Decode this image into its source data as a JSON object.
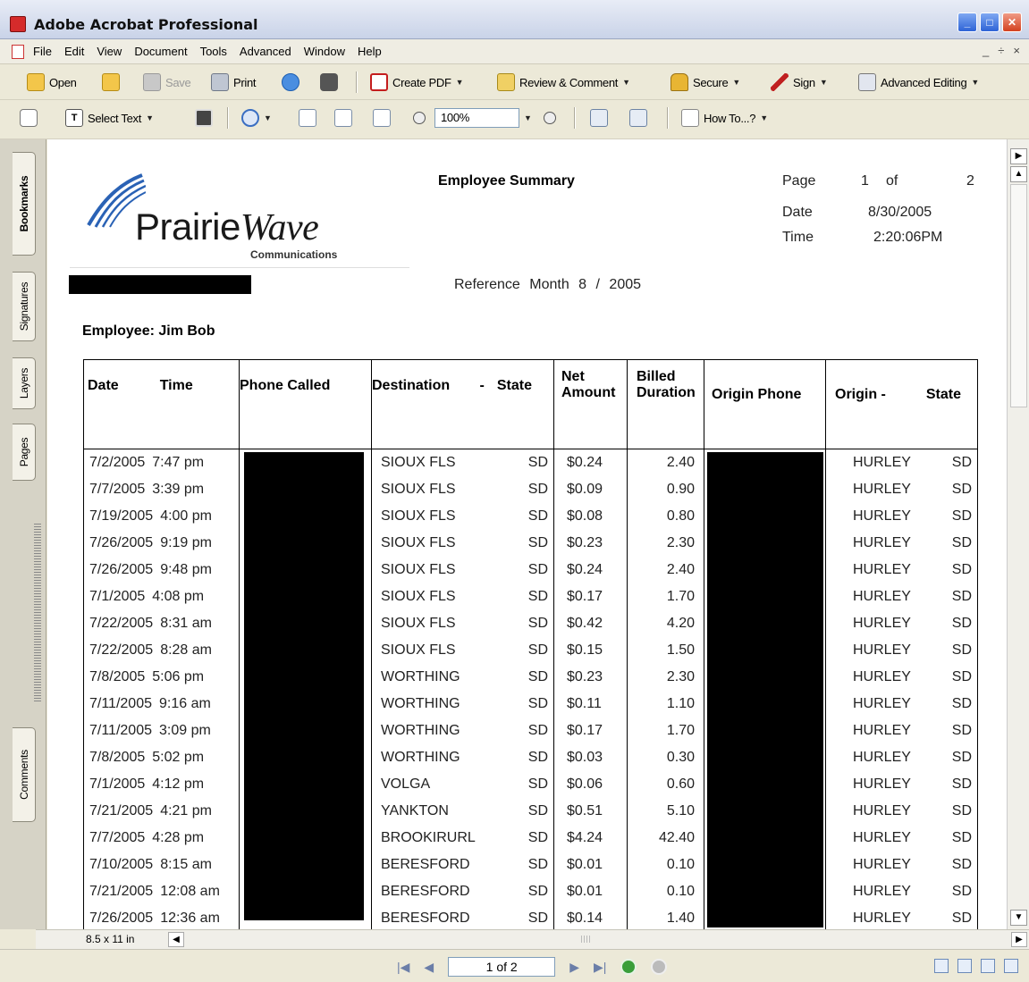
{
  "window": {
    "title": "Adobe Acrobat Professional"
  },
  "menubar": {
    "items": [
      "File",
      "Edit",
      "View",
      "Document",
      "Tools",
      "Advanced",
      "Window",
      "Help"
    ],
    "mdi_controls": [
      "_",
      "÷",
      "×"
    ]
  },
  "toolbar1": {
    "open": "Open",
    "save": "Save",
    "print": "Print",
    "create_pdf": "Create PDF",
    "review_comment": "Review & Comment",
    "secure": "Secure",
    "sign": "Sign",
    "advanced_editing": "Advanced Editing"
  },
  "toolbar2": {
    "select_text": "Select Text",
    "zoom_value": "100%",
    "how_to": "How To...?"
  },
  "nav_tabs": [
    "Bookmarks",
    "Signatures",
    "Layers",
    "Pages",
    "Comments"
  ],
  "document": {
    "logo_main": "Prairie",
    "logo_wave": "Wave",
    "logo_sub": "Communications",
    "title": "Employee Summary",
    "page_label": "Page",
    "page_num": "1",
    "page_of": "of",
    "page_total": "2",
    "date_label": "Date",
    "date_value": "8/30/2005",
    "time_label": "Time",
    "time_value": "2:20:06PM",
    "reference_month": "Reference Month   8  /  2005",
    "employee": "Employee:  Jim Bob",
    "headers": {
      "date": "Date",
      "time": "Time",
      "phone_called": "Phone Called",
      "destination": "Destination",
      "dash": "-",
      "state": "State",
      "net_amount_1": "Net",
      "net_amount_2": "Amount",
      "billed_1": "Billed",
      "billed_2": "Duration",
      "origin_phone": "Origin Phone",
      "origin": "Origin -",
      "origin_state": "State"
    },
    "rows": [
      {
        "date": "7/2/2005",
        "time": "7:47 pm",
        "dest": "SIOUX FLS",
        "state": "SD",
        "amount": "$0.24",
        "duration": "2.40",
        "origin": "HURLEY",
        "ostate": "SD"
      },
      {
        "date": "7/7/2005",
        "time": "3:39 pm",
        "dest": "SIOUX FLS",
        "state": "SD",
        "amount": "$0.09",
        "duration": "0.90",
        "origin": "HURLEY",
        "ostate": "SD"
      },
      {
        "date": "7/19/2005",
        "time": "4:00 pm",
        "dest": "SIOUX FLS",
        "state": "SD",
        "amount": "$0.08",
        "duration": "0.80",
        "origin": "HURLEY",
        "ostate": "SD"
      },
      {
        "date": "7/26/2005",
        "time": "9:19 pm",
        "dest": "SIOUX FLS",
        "state": "SD",
        "amount": "$0.23",
        "duration": "2.30",
        "origin": "HURLEY",
        "ostate": "SD"
      },
      {
        "date": "7/26/2005",
        "time": "9:48 pm",
        "dest": "SIOUX FLS",
        "state": "SD",
        "amount": "$0.24",
        "duration": "2.40",
        "origin": "HURLEY",
        "ostate": "SD"
      },
      {
        "date": "7/1/2005",
        "time": "4:08 pm",
        "dest": "SIOUX FLS",
        "state": "SD",
        "amount": "$0.17",
        "duration": "1.70",
        "origin": "HURLEY",
        "ostate": "SD"
      },
      {
        "date": "7/22/2005",
        "time": "8:31 am",
        "dest": "SIOUX FLS",
        "state": "SD",
        "amount": "$0.42",
        "duration": "4.20",
        "origin": "HURLEY",
        "ostate": "SD"
      },
      {
        "date": "7/22/2005",
        "time": "8:28 am",
        "dest": "SIOUX FLS",
        "state": "SD",
        "amount": "$0.15",
        "duration": "1.50",
        "origin": "HURLEY",
        "ostate": "SD"
      },
      {
        "date": "7/8/2005",
        "time": "5:06 pm",
        "dest": "WORTHING",
        "state": "SD",
        "amount": "$0.23",
        "duration": "2.30",
        "origin": "HURLEY",
        "ostate": "SD"
      },
      {
        "date": "7/11/2005",
        "time": "9:16 am",
        "dest": "WORTHING",
        "state": "SD",
        "amount": "$0.11",
        "duration": "1.10",
        "origin": "HURLEY",
        "ostate": "SD"
      },
      {
        "date": "7/11/2005",
        "time": "3:09 pm",
        "dest": "WORTHING",
        "state": "SD",
        "amount": "$0.17",
        "duration": "1.70",
        "origin": "HURLEY",
        "ostate": "SD"
      },
      {
        "date": "7/8/2005",
        "time": "5:02 pm",
        "dest": "WORTHING",
        "state": "SD",
        "amount": "$0.03",
        "duration": "0.30",
        "origin": "HURLEY",
        "ostate": "SD"
      },
      {
        "date": "7/1/2005",
        "time": "4:12 pm",
        "dest": "VOLGA",
        "state": "SD",
        "amount": "$0.06",
        "duration": "0.60",
        "origin": "HURLEY",
        "ostate": "SD"
      },
      {
        "date": "7/21/2005",
        "time": "4:21 pm",
        "dest": "YANKTON",
        "state": "SD",
        "amount": "$0.51",
        "duration": "5.10",
        "origin": "HURLEY",
        "ostate": "SD"
      },
      {
        "date": "7/7/2005",
        "time": "4:28 pm",
        "dest": "BROOKIRURL",
        "state": "SD",
        "amount": "$4.24",
        "duration": "42.40",
        "origin": "HURLEY",
        "ostate": "SD"
      },
      {
        "date": "7/10/2005",
        "time": "8:15 am",
        "dest": "BERESFORD",
        "state": "SD",
        "amount": "$0.01",
        "duration": "0.10",
        "origin": "HURLEY",
        "ostate": "SD"
      },
      {
        "date": "7/21/2005",
        "time": "12:08 am",
        "dest": "BERESFORD",
        "state": "SD",
        "amount": "$0.01",
        "duration": "0.10",
        "origin": "HURLEY",
        "ostate": "SD"
      },
      {
        "date": "7/26/2005",
        "time": "12:36 am",
        "dest": "BERESFORD",
        "state": "SD",
        "amount": "$0.14",
        "duration": "1.40",
        "origin": "HURLEY",
        "ostate": "SD"
      }
    ]
  },
  "hscroll": {
    "page_size": "8.5 x 11 in"
  },
  "statusbar": {
    "page_indicator": "1 of 2"
  }
}
